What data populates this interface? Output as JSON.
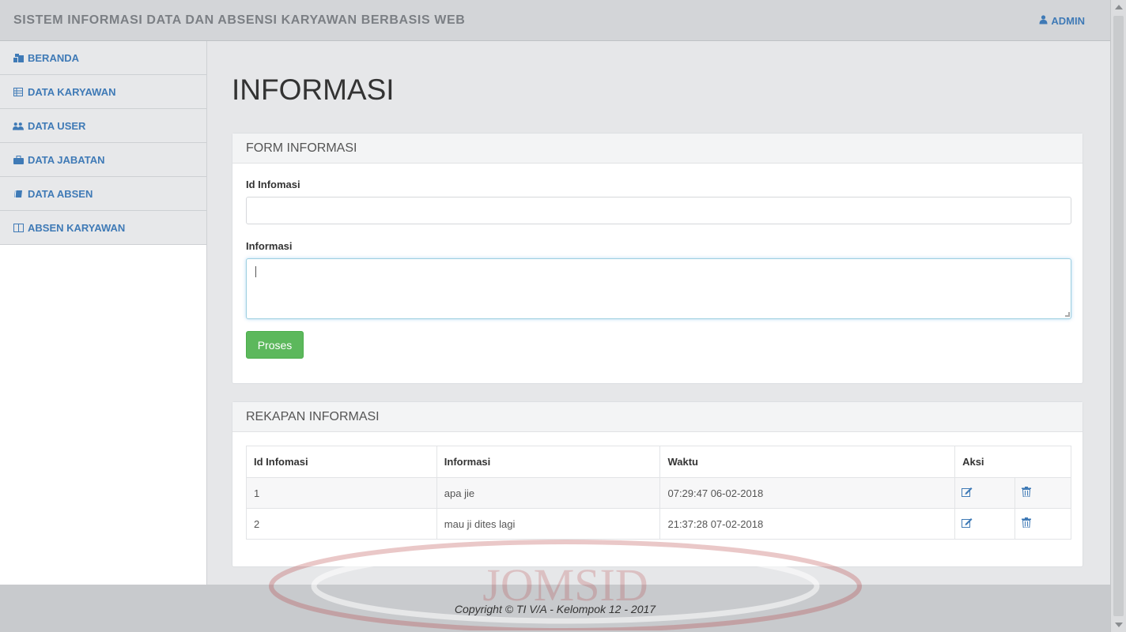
{
  "header": {
    "app_title": "SISTEM INFORMASI DATA DAN ABSENSI KARYAWAN BERBASIS WEB",
    "user_label": "ADMIN",
    "user_icon": "user-icon"
  },
  "sidebar": {
    "items": [
      {
        "label": "BERANDA",
        "icon": "dashboard-icon"
      },
      {
        "label": "DATA KARYAWAN",
        "icon": "list-icon"
      },
      {
        "label": "DATA USER",
        "icon": "users-icon"
      },
      {
        "label": "DATA JABATAN",
        "icon": "briefcase-icon"
      },
      {
        "label": "DATA ABSEN",
        "icon": "book-icon"
      },
      {
        "label": "ABSEN KARYAWAN",
        "icon": "columns-icon"
      }
    ]
  },
  "page": {
    "title": "INFORMASI"
  },
  "form": {
    "heading": "FORM INFORMASI",
    "id_label": "Id Infomasi",
    "id_value": "",
    "info_label": "Informasi",
    "info_value": "",
    "submit_label": "Proses",
    "submit_color": "#5cb85c"
  },
  "recap": {
    "heading": "REKAPAN INFORMASI",
    "columns": [
      "Id Infomasi",
      "Informasi",
      "Waktu",
      "Aksi"
    ],
    "rows": [
      {
        "id": "1",
        "info": "apa jie",
        "time": "07:29:47 06-02-2018"
      },
      {
        "id": "2",
        "info": "mau ji dites lagi",
        "time": "21:37:28 07-02-2018"
      }
    ],
    "edit_icon": "edit-icon",
    "delete_icon": "trash-icon"
  },
  "footer": {
    "text": "Copyright © TI V/A - Kelompok 12 - 2017"
  },
  "watermark": {
    "text": "JOMSID"
  },
  "colors": {
    "accent": "#3f7ab6",
    "success": "#5cb85c"
  }
}
